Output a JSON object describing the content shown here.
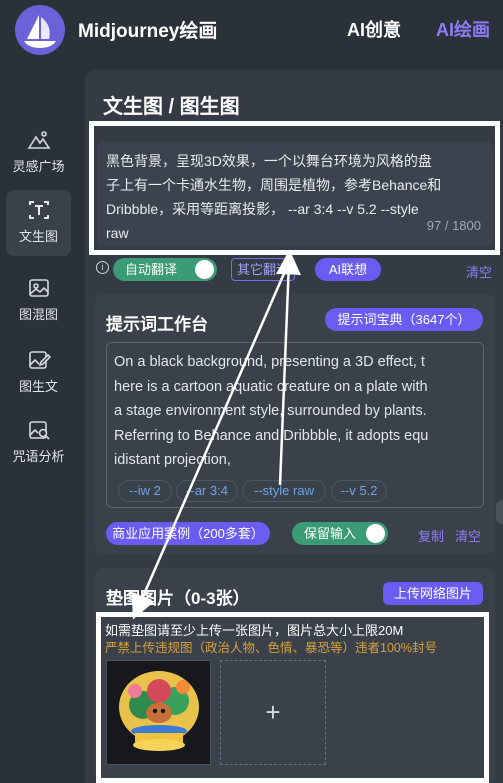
{
  "header": {
    "app_title": "Midjourney绘画",
    "nav": [
      {
        "label": "AI创意",
        "active": false
      },
      {
        "label": "AI绘画",
        "active": true
      }
    ]
  },
  "sidebar": {
    "items": [
      {
        "label": "灵感广场",
        "icon": "mountain-icon",
        "active": false
      },
      {
        "label": "文生图",
        "icon": "text-t-icon",
        "active": true
      },
      {
        "label": "图混图",
        "icon": "image-icon",
        "active": false
      },
      {
        "label": "图生文",
        "icon": "image-edit-icon",
        "active": false
      },
      {
        "label": "咒语分析",
        "icon": "image-search-icon",
        "active": false
      }
    ]
  },
  "main": {
    "title": "文生图 / 图生图",
    "prompt": {
      "lines": [
        "黑色背景，呈现3D效果，一个以舞台环境为风格的盘",
        "子上有一个卡通水生物，周围是植物，参考Behance和",
        "Dribbble，采用等距离投影， --ar 3:4 --v 5.2 --style",
        "raw"
      ],
      "count": "97 / 1800"
    },
    "toolbar": {
      "auto_translate": "自动翻译",
      "auto_translate_on": true,
      "other_translate": "其它翻译",
      "ai_associate": "AI联想",
      "clear": "清空"
    },
    "workbench": {
      "title": "提示词工作台",
      "dictionary_button": "提示词宝典（3647个）",
      "english_lines": [
        "On a black background, presenting a 3D effect, t",
        "here is a cartoon aquatic creature on a plate with",
        "a stage environment style, surrounded by plants.",
        "Referring to Behance and Dribbble, it adopts equ",
        "idistant projection,"
      ],
      "tags": [
        "--iw 2",
        "--ar 3:4",
        "--style raw",
        "--v 5.2"
      ],
      "cases_button": "商业应用案例（200多套）",
      "keep_input": "保留输入",
      "keep_input_on": true,
      "copy": "复制",
      "clear": "清空"
    },
    "reference": {
      "title": "垫图图片（0-3张）",
      "upload_button": "上传网络图片",
      "hint": "如需垫图请至少上传一张图片，图片总大小上限20M",
      "warning": "严禁上传违规图（政治人物、色情、暴恐等）违者100%封号",
      "add_symbol": "+"
    }
  },
  "colors": {
    "accent": "#6a5cf0",
    "accent_text": "#8e7cf6",
    "green": "#3b9b75",
    "warning": "#d8a03a",
    "panel": "#343b45",
    "background": "#2a3038"
  }
}
